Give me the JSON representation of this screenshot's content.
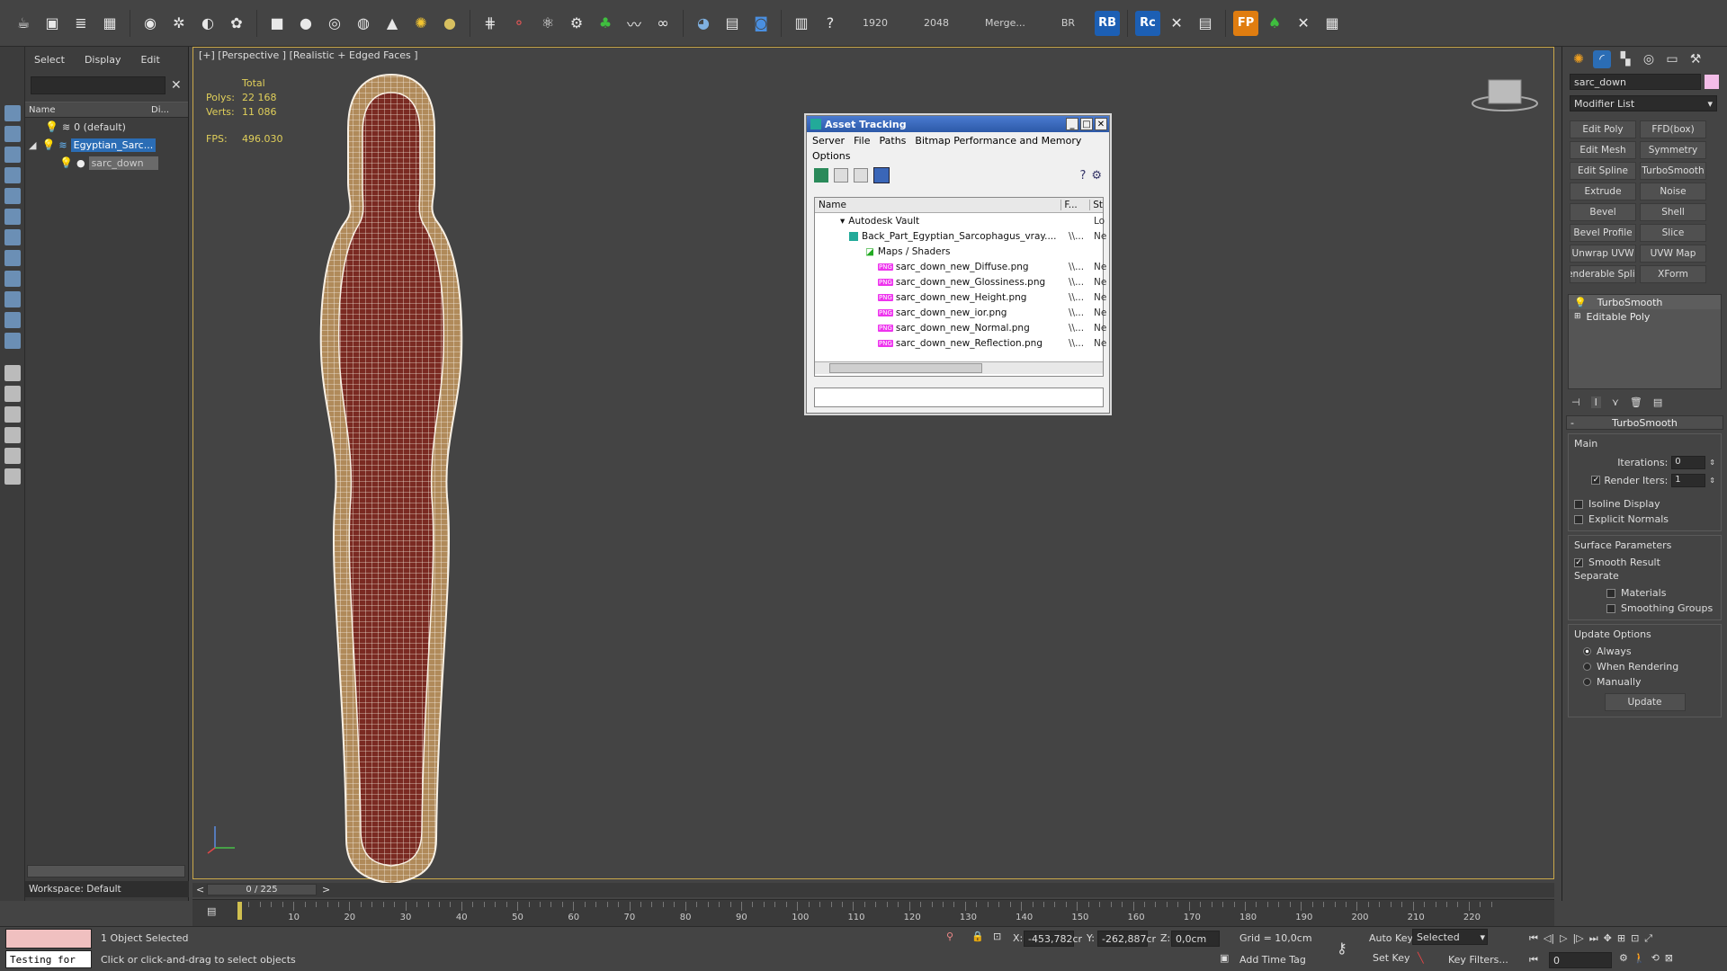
{
  "toolbar": {
    "icons": [
      "teapot-icon",
      "render-icon",
      "layers-icon",
      "schematic-icon",
      "bulb-icon",
      "wind-icon",
      "helix-icon",
      "particles-icon",
      "box-icon",
      "sphere-icon",
      "torus-icon",
      "geosphere-icon",
      "cone-icon",
      "sun-icon",
      "ring-icon",
      "grid-icon",
      "molecule-icon",
      "atom-icon",
      "gear-icon",
      "bush-icon",
      "hair-icon",
      "rope-icon",
      "globe-icon",
      "material-icon",
      "render-setup-icon",
      "tool-icon",
      "help-icon"
    ],
    "numbers": [
      "1920",
      "2048",
      "Merge...",
      "BR"
    ],
    "rb_label": "RB",
    "rc_label": "Rc",
    "fp_label": "FP"
  },
  "explorer": {
    "menu": [
      "Select",
      "Display",
      "Edit"
    ],
    "col_name": "Name",
    "col_display": "Di...",
    "rows": [
      "0 (default)",
      "Egyptian_Sarc...",
      "sarc_down"
    ],
    "workspace": "Workspace: Default"
  },
  "viewport": {
    "label": "[+] [Perspective ] [Realistic + Edged Faces ]",
    "stats_total": "Total",
    "polys_label": "Polys:",
    "polys_value": "22 168",
    "verts_label": "Verts:",
    "verts_value": "11 086",
    "fps_label": "FPS:",
    "fps_value": "496.030"
  },
  "asset": {
    "title": "Asset Tracking",
    "menu": [
      "Server",
      "File",
      "Paths",
      "Bitmap Performance and Memory"
    ],
    "menu2": "Options",
    "col_name": "Name",
    "col_f": "F...",
    "col_st": "St",
    "items": [
      {
        "name": "Autodesk Vault",
        "f": "",
        "st": "Lo"
      },
      {
        "name": "Back_Part_Egyptian_Sarcophagus_vray....",
        "f": "\\\\...",
        "st": "Ne"
      },
      {
        "name": "Maps / Shaders",
        "f": "",
        "st": ""
      },
      {
        "name": "sarc_down_new_Diffuse.png",
        "f": "\\\\...",
        "st": "Ne"
      },
      {
        "name": "sarc_down_new_Glossiness.png",
        "f": "\\\\...",
        "st": "Ne"
      },
      {
        "name": "sarc_down_new_Height.png",
        "f": "\\\\...",
        "st": "Ne"
      },
      {
        "name": "sarc_down_new_ior.png",
        "f": "\\\\...",
        "st": "Ne"
      },
      {
        "name": "sarc_down_new_Normal.png",
        "f": "\\\\...",
        "st": "Ne"
      },
      {
        "name": "sarc_down_new_Reflection.png",
        "f": "\\\\...",
        "st": "Ne"
      }
    ]
  },
  "command": {
    "object_name": "sarc_down",
    "modifier_list": "Modifier List",
    "modifiers": [
      "Edit Poly",
      "FFD(box)",
      "Edit Mesh",
      "Symmetry",
      "Edit Spline",
      "TurboSmooth",
      "Extrude",
      "Noise",
      "Bevel",
      "Shell",
      "Bevel Profile",
      "Slice",
      "Unwrap UVW",
      "UVW Map",
      "enderable Splir",
      "XForm"
    ],
    "stack": [
      "TurboSmooth",
      "Editable Poly"
    ],
    "rollout_title": "TurboSmooth",
    "main_label": "Main",
    "iterations_label": "Iterations:",
    "iterations_value": "0",
    "render_iters_label": "Render Iters:",
    "render_iters_value": "1",
    "isoline": "Isoline Display",
    "explicit": "Explicit Normals",
    "surface_params": "Surface Parameters",
    "smooth_result": "Smooth Result",
    "separate": "Separate",
    "materials": "Materials",
    "smoothing_groups": "Smoothing Groups",
    "update_options": "Update Options",
    "always": "Always",
    "when_rendering": "When Rendering",
    "manually": "Manually",
    "update_btn": "Update"
  },
  "timeline": {
    "frame": "0 / 225",
    "ticks": [
      "10",
      "20",
      "30",
      "40",
      "50",
      "60",
      "70",
      "80",
      "90",
      "100",
      "110",
      "120",
      "130",
      "140",
      "150",
      "160",
      "170",
      "180",
      "190",
      "200",
      "210",
      "220"
    ]
  },
  "status": {
    "script_text": "Testing for",
    "selected": "1 Object Selected",
    "prompt": "Click or click-and-drag to select objects",
    "x_label": "X:",
    "x_value": "-453,782cr",
    "y_label": "Y:",
    "y_value": "-262,887cr",
    "z_label": "Z:",
    "z_value": "0,0cm",
    "grid": "Grid = 10,0cm",
    "add_time_tag": "Add Time Tag",
    "auto_key": "Auto Key",
    "set_key": "Set Key",
    "selected_dropdown": "Selected",
    "key_filters": "Key Filters...",
    "frame_value": "0"
  }
}
